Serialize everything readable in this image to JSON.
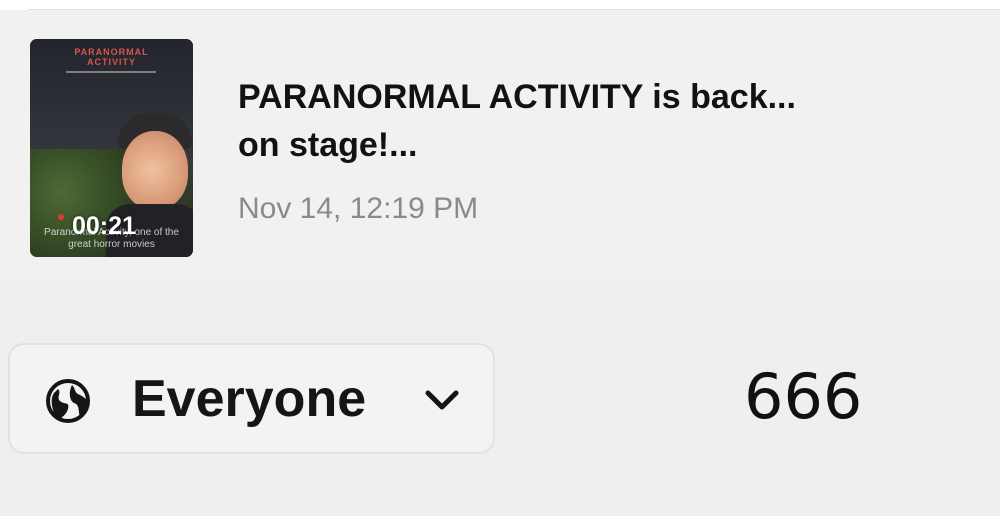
{
  "post": {
    "thumbnail": {
      "poster_title": "PARANORMAL\nACTIVITY",
      "caption": "Paranormal Activity, one of the great horror movies",
      "duration": "00:21"
    },
    "title": "PARANORMAL ACTIVITY is back...\non stage!...",
    "date": "Nov 14, 12:19 PM"
  },
  "visibility": {
    "icon": "globe-icon",
    "selected": "Everyone",
    "dropdown_icon": "chevron-down-icon"
  },
  "stats": {
    "views": "666"
  },
  "colors": {
    "background": "#f1f1f1",
    "title_text": "#121212",
    "date_text": "#8a8a8a",
    "border": "#e2e2e2"
  }
}
